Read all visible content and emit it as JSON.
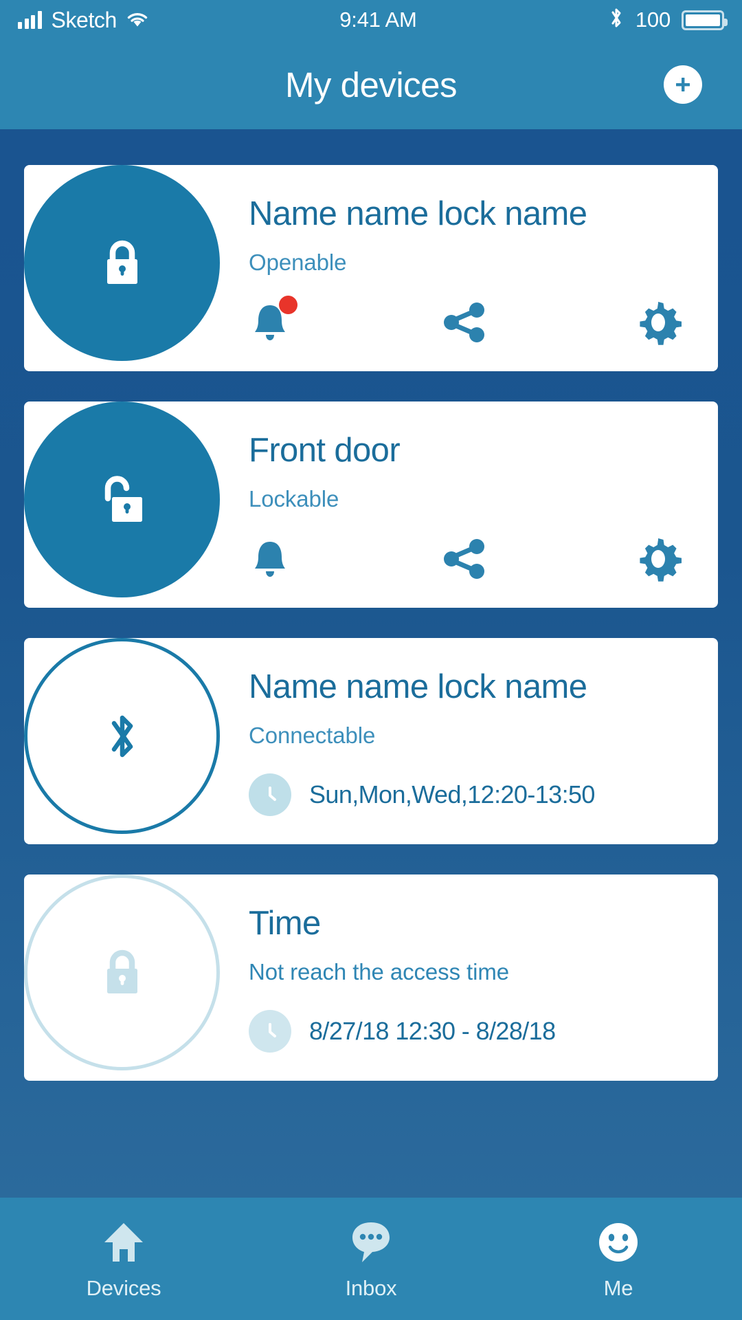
{
  "status_bar": {
    "carrier": "Sketch",
    "time": "9:41 AM",
    "battery_level": "100",
    "icons": {
      "signal": "signal-bars-icon",
      "wifi": "wifi-icon",
      "bluetooth": "bluetooth-icon",
      "battery": "battery-icon"
    }
  },
  "header": {
    "title": "My devices",
    "add_button": "add-device-button",
    "background": "#2d86b2"
  },
  "theme": {
    "header_blue": "#2d86b2",
    "body_blue": "#1a5490",
    "accent_blue": "#1a7aa8",
    "title_blue": "#1b6d9b",
    "subtitle_blue": "#3d8fbb",
    "badge_red": "#e8342a",
    "pale_blue": "#bfdfe9",
    "card_white": "#ffffff"
  },
  "devices": [
    {
      "name": "Name name lock name",
      "status": "Openable",
      "icon": "lock-closed-icon",
      "circle_style": "filled",
      "disabled": false,
      "actions": [
        {
          "name": "notification-bell-icon",
          "label": "Notifications",
          "badge": true
        },
        {
          "name": "share-icon",
          "label": "Share",
          "badge": false
        },
        {
          "name": "settings-gear-icon",
          "label": "Settings",
          "badge": false
        }
      ]
    },
    {
      "name": "Front door",
      "status": "Lockable",
      "icon": "lock-open-icon",
      "circle_style": "filled",
      "disabled": false,
      "actions": [
        {
          "name": "notification-bell-icon",
          "label": "Notifications",
          "badge": false
        },
        {
          "name": "share-icon",
          "label": "Share",
          "badge": false
        },
        {
          "name": "settings-gear-icon",
          "label": "Settings",
          "badge": false
        }
      ]
    },
    {
      "name": "Name name lock name",
      "status": "Connectable",
      "icon": "bluetooth-icon",
      "circle_style": "outline",
      "disabled": false,
      "schedule": "Sun,Mon,Wed,12:20-13:50"
    },
    {
      "name": "Time",
      "status": "Not reach the access time",
      "icon": "lock-closed-icon",
      "circle_style": "faded",
      "disabled": true,
      "schedule": "8/27/18 12:30 - 8/28/18"
    }
  ],
  "tabs": [
    {
      "label": "Devices",
      "icon": "home-icon",
      "active": true
    },
    {
      "label": "Inbox",
      "icon": "chat-bubble-icon",
      "active": false
    },
    {
      "label": "Me",
      "icon": "smiley-face-icon",
      "active": false
    }
  ]
}
